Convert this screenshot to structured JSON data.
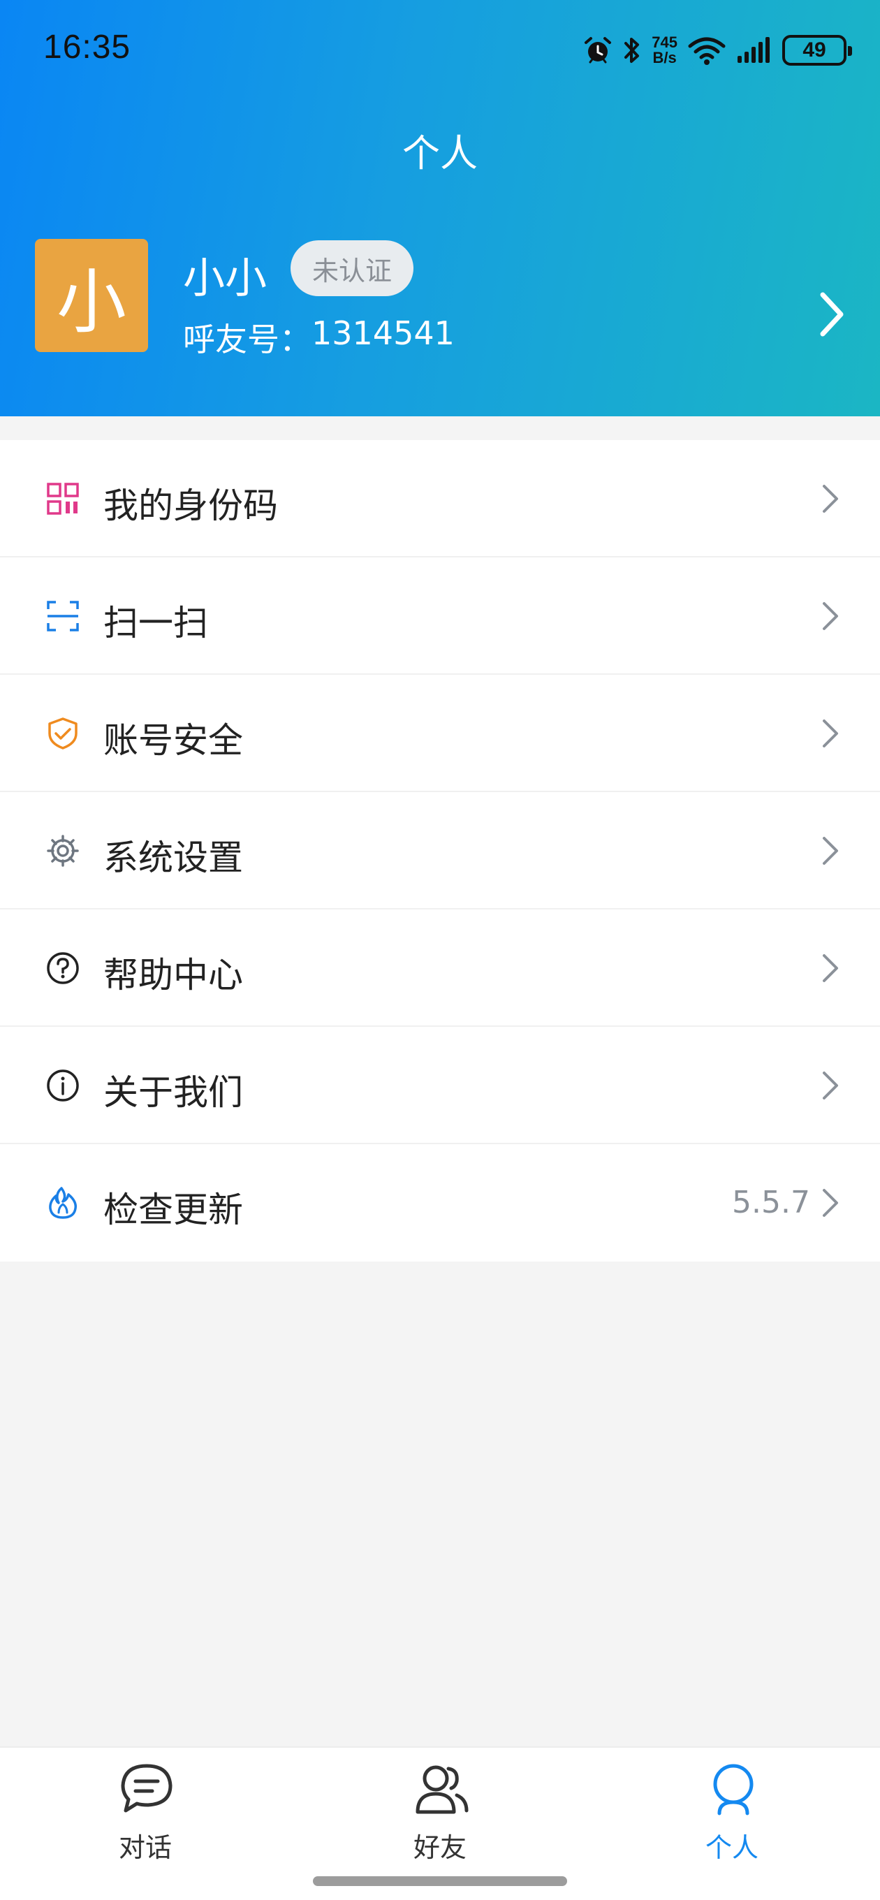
{
  "status_bar": {
    "time": "16:35",
    "net_speed_value": "745",
    "net_speed_unit": "B/s",
    "battery": "49",
    "icons": [
      "alarm-icon",
      "bluetooth-icon",
      "wifi-icon",
      "signal-icon",
      "battery-icon"
    ]
  },
  "page": {
    "title": "个人"
  },
  "profile": {
    "avatar_text": "小",
    "avatar_color": "#e9a441",
    "name": "小小",
    "verify_status": "未认证",
    "id_label": "呼友号：",
    "id_value": "1314541"
  },
  "menu": {
    "items": [
      {
        "label": "我的身份码",
        "icon": "qr-code-icon",
        "value": ""
      },
      {
        "label": "扫一扫",
        "icon": "scan-icon",
        "value": ""
      },
      {
        "label": "账号安全",
        "icon": "shield-check-icon",
        "value": ""
      },
      {
        "label": "系统设置",
        "icon": "gear-icon",
        "value": ""
      },
      {
        "label": "帮助中心",
        "icon": "question-icon",
        "value": ""
      },
      {
        "label": "关于我们",
        "icon": "info-icon",
        "value": ""
      },
      {
        "label": "检查更新",
        "icon": "flame-icon",
        "value": "5.5.7"
      }
    ]
  },
  "tabbar": {
    "tabs": [
      {
        "label": "对话",
        "icon": "chat-bubble-icon",
        "active": false
      },
      {
        "label": "好友",
        "icon": "friends-icon",
        "active": false
      },
      {
        "label": "个人",
        "icon": "person-icon",
        "active": true
      }
    ]
  },
  "colors": {
    "header_gradient_start": "#0a86f4",
    "header_gradient_end": "#1bb6c4",
    "accent": "#1489f0",
    "qr_icon": "#e0398a",
    "scan_icon": "#1a7fe6",
    "shield_icon": "#ef8b1f",
    "flame_icon": "#1a7fe6"
  }
}
